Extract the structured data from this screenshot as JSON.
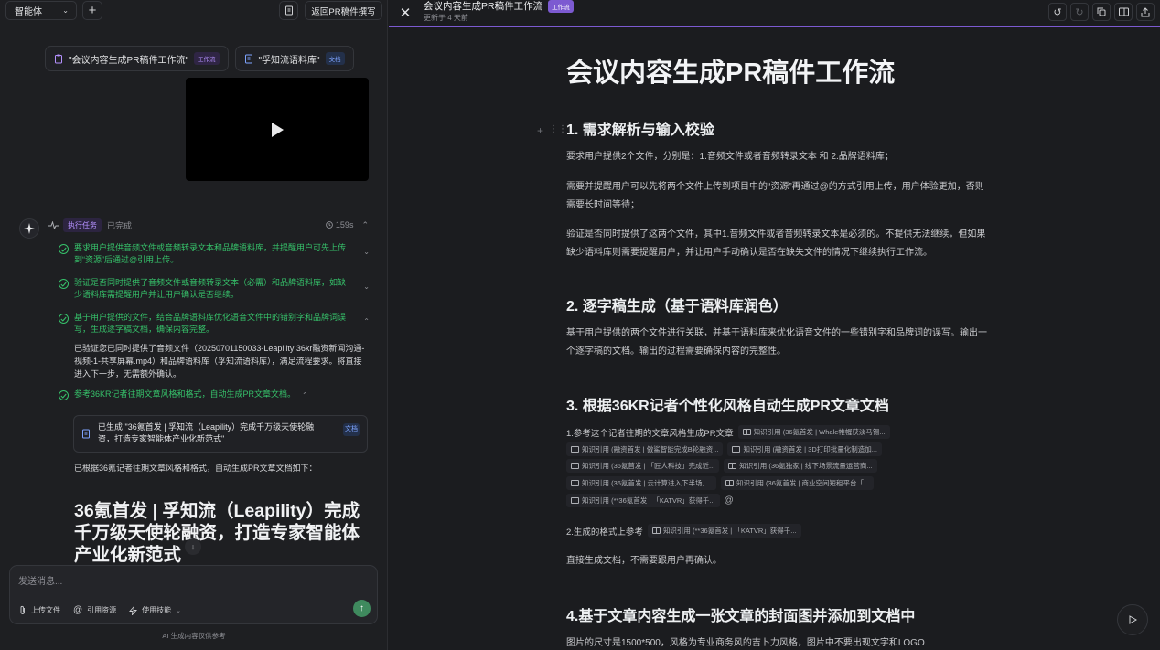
{
  "left": {
    "agent_select": "智能体",
    "back_button": "返回PR稿件撰写",
    "refs": [
      {
        "label": "\"会议内容生成PR稿件工作流\"",
        "tag": "工作流"
      },
      {
        "label": "\"孚知流语料库\"",
        "tag": "文档"
      }
    ],
    "task": {
      "pill": "执行任务",
      "status": "已完成",
      "time": "159s"
    },
    "steps": [
      {
        "text": "要求用户提供音频文件或音频转录文本和品牌语料库，并提醒用户可先上传到“资源”后通过@引用上传。"
      },
      {
        "text": "验证是否同时提供了音频文件或音频转录文本（必需）和品牌语料库，如缺少语料库需提醒用户并让用户确认是否继续。"
      },
      {
        "text": "基于用户提供的文件，结合品牌语料库优化语音文件中的错别字和品牌词误写，生成逐字稿文档，确保内容完整。"
      },
      {
        "text": "参考36KR记者往期文章风格和格式，自动生成PR文章文档。"
      }
    ],
    "step_body": "已验证您已同时提供了音频文件（20250701150033-Leapility 36kr融资新闻沟通-视频-1-共享屏幕.mp4）和品牌语料库（孚知流语料库），满足流程要求。将直接进入下一步，无需额外确认。",
    "file_card": {
      "text": "已生成 \"36氪首发 | 孚知流（Leapility）完成千万级天使轮融资，打造专家智能体产业化新范式\"",
      "tag": "文档"
    },
    "after_text": "已根据36氪记者往期文章风格和格式，自动生成PR文章文档如下：",
    "article_title": "36氪首发 | 孚知流（Leapility）完成千万级天使轮融资，打造专家智能体产业化新范式",
    "input": {
      "placeholder": "发送消息...",
      "upload": "上传文件",
      "reference": "引用资源",
      "skills": "使用技能"
    },
    "disclaimer": "AI 生成内容仅供参考"
  },
  "right": {
    "title": "会议内容生成PR稿件工作流",
    "title_tag": "工作流",
    "updated": "更新于 4 天前",
    "doc_title": "会议内容生成PR稿件工作流",
    "sections": [
      {
        "heading": "1. 需求解析与输入校验",
        "paras": [
          "要求用户提供2个文件，分别是：1.音频文件或者音频转录文本 和 2.品牌语料库；",
          "需要并提醒用户可以先将两个文件上传到项目中的“资源”再通过@的方式引用上传，用户体验更加，否则需要长时间等待；",
          "验证是否同时提供了这两个文件，其中1.音频文件或者音频转录文本是必须的。不提供无法继续。但如果缺少语料库则需要提醒用户，并让用户手动确认是否在缺失文件的情况下继续执行工作流。"
        ]
      },
      {
        "heading": "2. 逐字稿生成（基于语料库润色）",
        "paras": [
          "基于用户提供的两个文件进行关联，并基于语料库来优化语音文件的一些错别字和品牌词的误写。输出一个逐字稿的文档。输出的过程需要确保内容的完整性。"
        ]
      },
      {
        "heading": "3. 根据36KR记者个性化风格自动生成PR文章文档",
        "line1": "1.参考这个记者往期的文章风格生成PR文章",
        "chips": [
          "知识引用 (36氪首发 | Whale帷幄获淡马锡...",
          "知识引用 (融资首发 | 傲鲨智能完成B轮融资...",
          "知识引用 (融资首发 | 3D打印批量化制造加...",
          "知识引用 (36氪首发 | 「匠人科技」完成近...",
          "知识引用 (36氪独家 | 线下场景流量运营商...",
          "知识引用 (36氪首发 | 云计算进入下半场, ...",
          "知识引用 (36氪首发 | 商业空间短租平台「...",
          "知识引用 (**36氪首发 | 「KATVR」获得千..."
        ],
        "line2": "2.生成的格式上参考",
        "chip2": "知识引用 (**36氪首发 | 「KATVR」获得千...",
        "line3": "直接生成文档，不需要跟用户再确认。"
      },
      {
        "heading": "4.基于文章内容生成一张文章的封面图并添加到文档中",
        "para": "图片的尺寸是1500*500，风格为专业商务风的吉卜力风格，图片中不要出现文字和LOGO"
      }
    ]
  }
}
